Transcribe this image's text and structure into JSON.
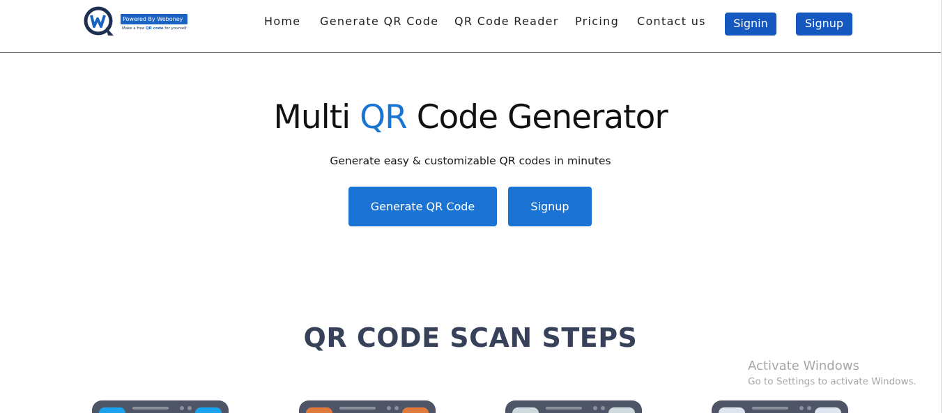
{
  "logo": {
    "badge": "Powered By Weboney",
    "tagline_pre": "Make a free ",
    "tagline_qr": "QR code",
    "tagline_post": " for yourself"
  },
  "nav": {
    "items": [
      {
        "label": "Home"
      },
      {
        "label": "Generate QR Code"
      },
      {
        "label": "QR Code Reader"
      },
      {
        "label": "Pricing"
      },
      {
        "label": "Contact us"
      }
    ],
    "signin_label": "Signin",
    "signup_label": "Signup"
  },
  "hero": {
    "title_pre": "Multi ",
    "title_accent": "QR",
    "title_post": " Code Generator",
    "subtitle": "Generate easy & customizable QR codes in minutes",
    "primary_button": "Generate QR Code",
    "secondary_button": "Signup"
  },
  "steps": {
    "title": "QR CODE SCAN STEPS",
    "cards": [
      {
        "accent": "#1aa3ec"
      },
      {
        "accent": "#e07a3c"
      },
      {
        "accent": "#cfd9de"
      },
      {
        "accent": "#dfe4ee"
      }
    ]
  },
  "watermark": {
    "line1": "Activate Windows",
    "line2": "Go to Settings to activate Windows."
  },
  "colors": {
    "brand_blue": "#1559c0",
    "accent_blue": "#1a74d2",
    "section_title": "#37425a"
  }
}
